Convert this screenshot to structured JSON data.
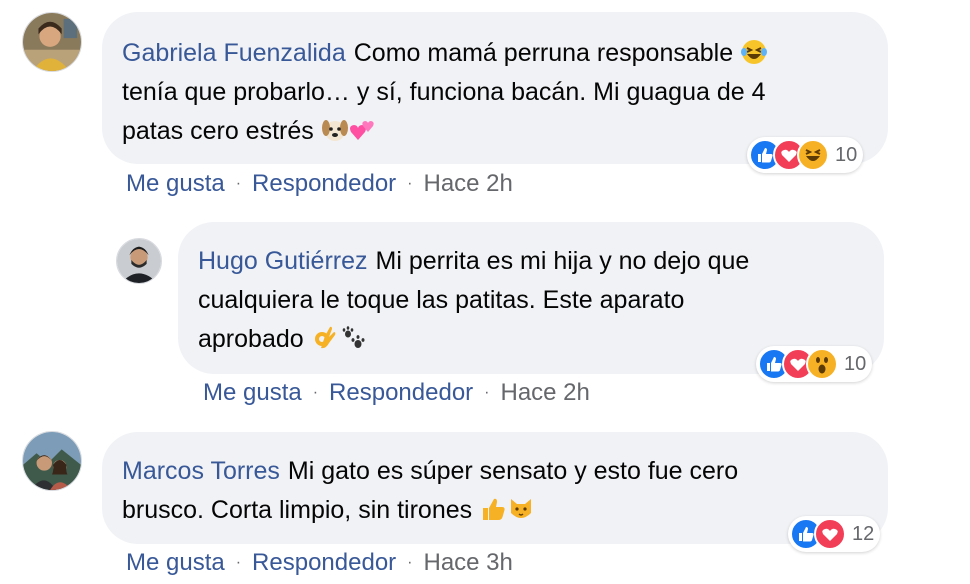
{
  "comments": [
    {
      "author": "Gabriela Fuenzalida",
      "lines": [
        "Como mamá perruna responsable",
        "tenía que probarlo… y sí, funciona bacán. Mi guagua de 4",
        "patas cero estrés"
      ],
      "emojis": [
        "laughing-face",
        "dog-face",
        "hearts"
      ],
      "reactions": [
        "like",
        "love",
        "haha"
      ],
      "reaction_count": "10",
      "like_label": "Me gusta",
      "reply_label": "Respondedor",
      "timestamp": "Hace 2h",
      "separator": "·"
    },
    {
      "author": "Hugo Gutiérrez",
      "lines": [
        "Mi perrita es mi hija y no dejo que",
        "cualquiera le toque las patitas. Este aparato",
        "aprobado"
      ],
      "emojis": [
        "ok-hand",
        "paw-prints"
      ],
      "reactions": [
        "like",
        "love",
        "wow"
      ],
      "reaction_count": "10",
      "like_label": "Me gusta",
      "reply_label": "Respondedor",
      "timestamp": "Hace 2h",
      "separator": "·"
    },
    {
      "author": "Marcos Torres",
      "lines": [
        "Mi gato es súper sensato y esto fue cero",
        "brusco. Corta limpio, sin tirones"
      ],
      "emojis": [
        "thumbs-up",
        "cat-face"
      ],
      "reactions": [
        "like",
        "love"
      ],
      "reaction_count": "12",
      "like_label": "Me gusta",
      "reply_label": "Respondedor",
      "timestamp": "Hace 3h",
      "separator": "·"
    }
  ],
  "colors": {
    "bubble": "#f0f2f5",
    "author": "#385898",
    "meta": "#65676b",
    "like": "#1877f2",
    "love": "#f33e58",
    "haha": "#f7b125"
  }
}
